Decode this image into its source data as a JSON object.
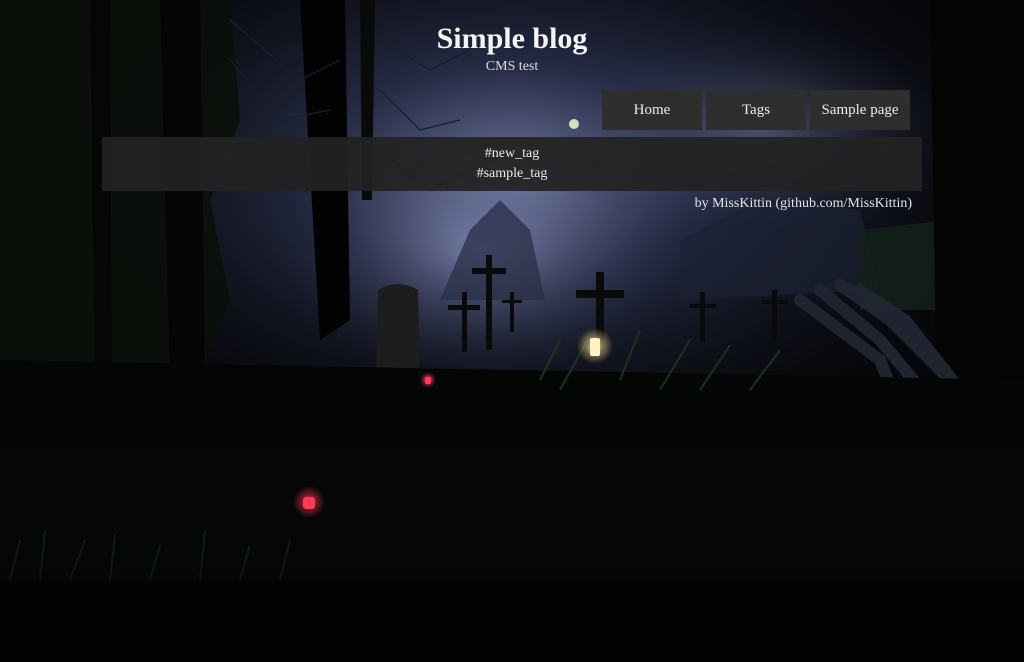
{
  "header": {
    "title": "Simple blog",
    "subtitle": "CMS test"
  },
  "nav": {
    "items": [
      {
        "label": "Home"
      },
      {
        "label": "Tags"
      },
      {
        "label": "Sample page"
      }
    ]
  },
  "tags": {
    "items": [
      {
        "label": "#new_tag"
      },
      {
        "label": "#sample_tag"
      }
    ]
  },
  "footer": {
    "credit": "by MissKittin (github.com/MissKittin)"
  },
  "colors": {
    "nav_background": "#2e2e2e",
    "panel_background": "#222222",
    "page_background": "#050505",
    "candle_glow": "#ff2a4a"
  }
}
